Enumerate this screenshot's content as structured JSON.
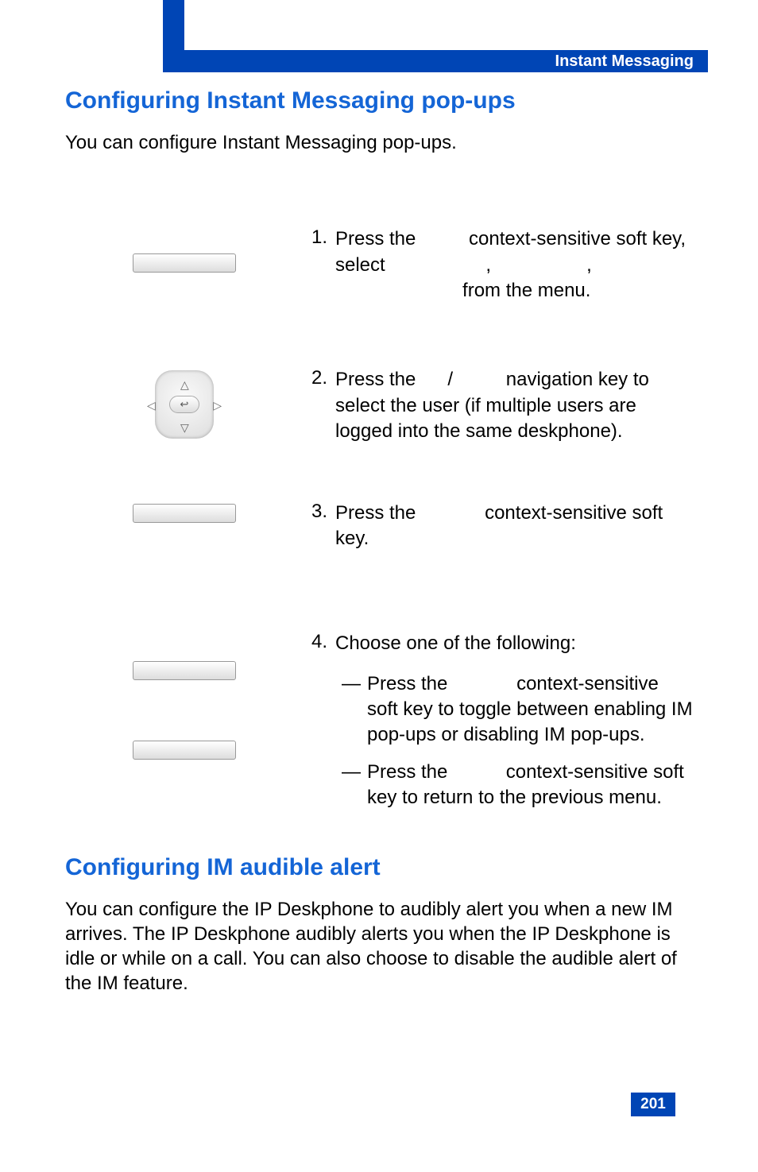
{
  "header": {
    "section_title": "Instant Messaging"
  },
  "section1": {
    "heading": "Configuring Instant Messaging pop-ups",
    "intro": "You can configure Instant Messaging pop-ups."
  },
  "steps": [
    {
      "num": "1.",
      "text_pre": "Press the ",
      "text_mid1": " context-sensitive soft key, select ",
      "text_mid2": ", ",
      "text_mid3": ", ",
      "text_end": " from the menu."
    },
    {
      "num": "2.",
      "text_pre": "Press the ",
      "text_slash": "/",
      "text_end": " navigation key to select the user (if multiple users are logged into the same deskphone)."
    },
    {
      "num": "3.",
      "text_pre": "Press the ",
      "text_end": " context-sensitive soft key."
    },
    {
      "num": "4.",
      "lead": "Choose one of the following:",
      "sub": [
        {
          "dash": "—",
          "pre": "Press the ",
          "end": " context-sensitive soft key to toggle between enabling IM pop-ups or disabling IM pop-ups."
        },
        {
          "dash": "—",
          "pre": "Press the ",
          "end": " context-sensitive soft key to return to the previous menu."
        }
      ]
    }
  ],
  "section2": {
    "heading": "Configuring IM audible alert",
    "body": "You can configure the IP Deskphone to audibly alert you when a new IM arrives. The IP Deskphone audibly alerts you when the IP Deskphone is idle or while on a call. You can also choose to disable the audible alert of the IM feature."
  },
  "page_number": "201"
}
